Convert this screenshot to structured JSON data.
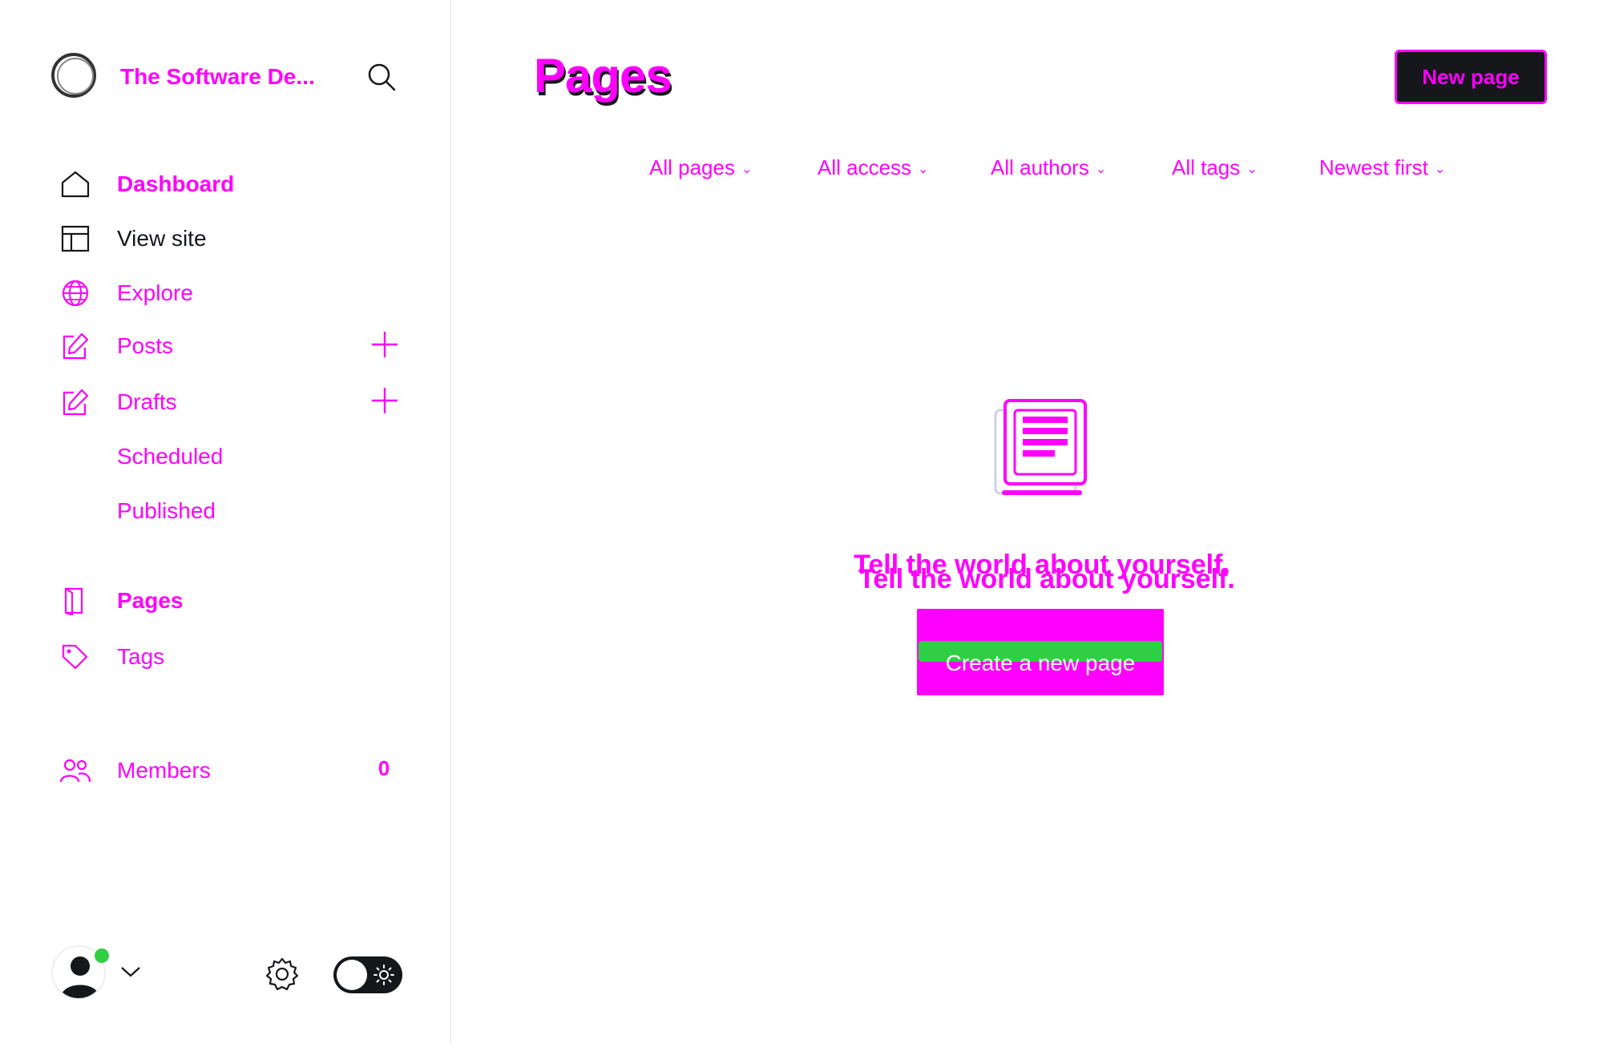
{
  "site": {
    "title": "The Software De..."
  },
  "nav": {
    "dashboard": "Dashboard",
    "view_site": "View site",
    "explore": "Explore",
    "posts": "Posts",
    "drafts": "Drafts",
    "scheduled": "Scheduled",
    "published": "Published",
    "pages": "Pages",
    "tags": "Tags",
    "members": "Members",
    "members_count": "0"
  },
  "header": {
    "title": "Pages",
    "new_page_label": "New page"
  },
  "filters": {
    "type": "All pages",
    "access": "All access",
    "authors": "All authors",
    "tags": "All tags",
    "sort": "Newest first"
  },
  "empty_state": {
    "message": "Tell the world about yourself.",
    "button_label": "Create a new page"
  },
  "colors": {
    "accent": "#ff00ff",
    "dark": "#15171a",
    "status_online": "#30cf43"
  }
}
